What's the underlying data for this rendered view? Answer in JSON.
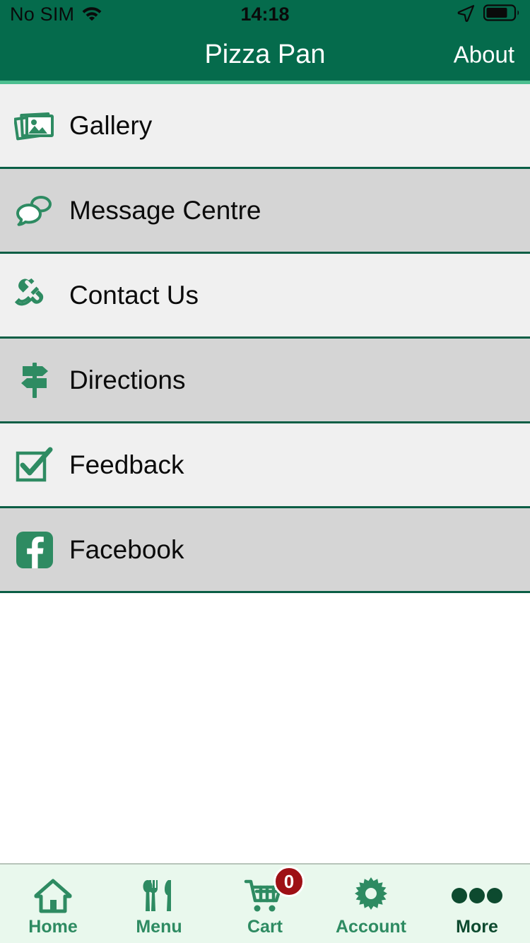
{
  "status_bar": {
    "carrier": "No SIM",
    "wifi_icon": "wifi-icon",
    "time": "14:18",
    "location_icon": "location-arrow-icon",
    "battery_icon": "battery-icon",
    "battery_level_percent": 72
  },
  "nav_bar": {
    "title": "Pizza Pan",
    "right_action": "About"
  },
  "menu": {
    "items": [
      {
        "label": "Gallery",
        "icon": "photos-stack-icon",
        "shade": "light"
      },
      {
        "label": "Message Centre",
        "icon": "speech-bubbles-icon",
        "shade": "dark"
      },
      {
        "label": "Contact Us",
        "icon": "phone-handset-icon",
        "shade": "light"
      },
      {
        "label": "Directions",
        "icon": "signpost-icon",
        "shade": "dark"
      },
      {
        "label": "Feedback",
        "icon": "checkbox-check-icon",
        "shade": "light"
      },
      {
        "label": "Facebook",
        "icon": "facebook-icon",
        "shade": "dark"
      }
    ]
  },
  "tab_bar": {
    "tabs": [
      {
        "label": "Home",
        "icon": "house-icon",
        "active": false
      },
      {
        "label": "Menu",
        "icon": "cutlery-icon",
        "active": false
      },
      {
        "label": "Cart",
        "icon": "shopping-cart-icon",
        "active": false,
        "badge": "0"
      },
      {
        "label": "Account",
        "icon": "gear-icon",
        "active": false
      },
      {
        "label": "More",
        "icon": "ellipsis-icon",
        "active": true
      }
    ]
  },
  "colors": {
    "brand_green": "#056b4c",
    "accent_green": "#2e8b62",
    "active_green": "#0d4a2f",
    "divider_green": "#0a5e45",
    "nav_underline": "#4cbf90",
    "row_light": "#f0f0f0",
    "row_dark": "#d5d5d5",
    "tabbar_bg": "#e9f8ed",
    "badge_red": "#9e1015"
  }
}
